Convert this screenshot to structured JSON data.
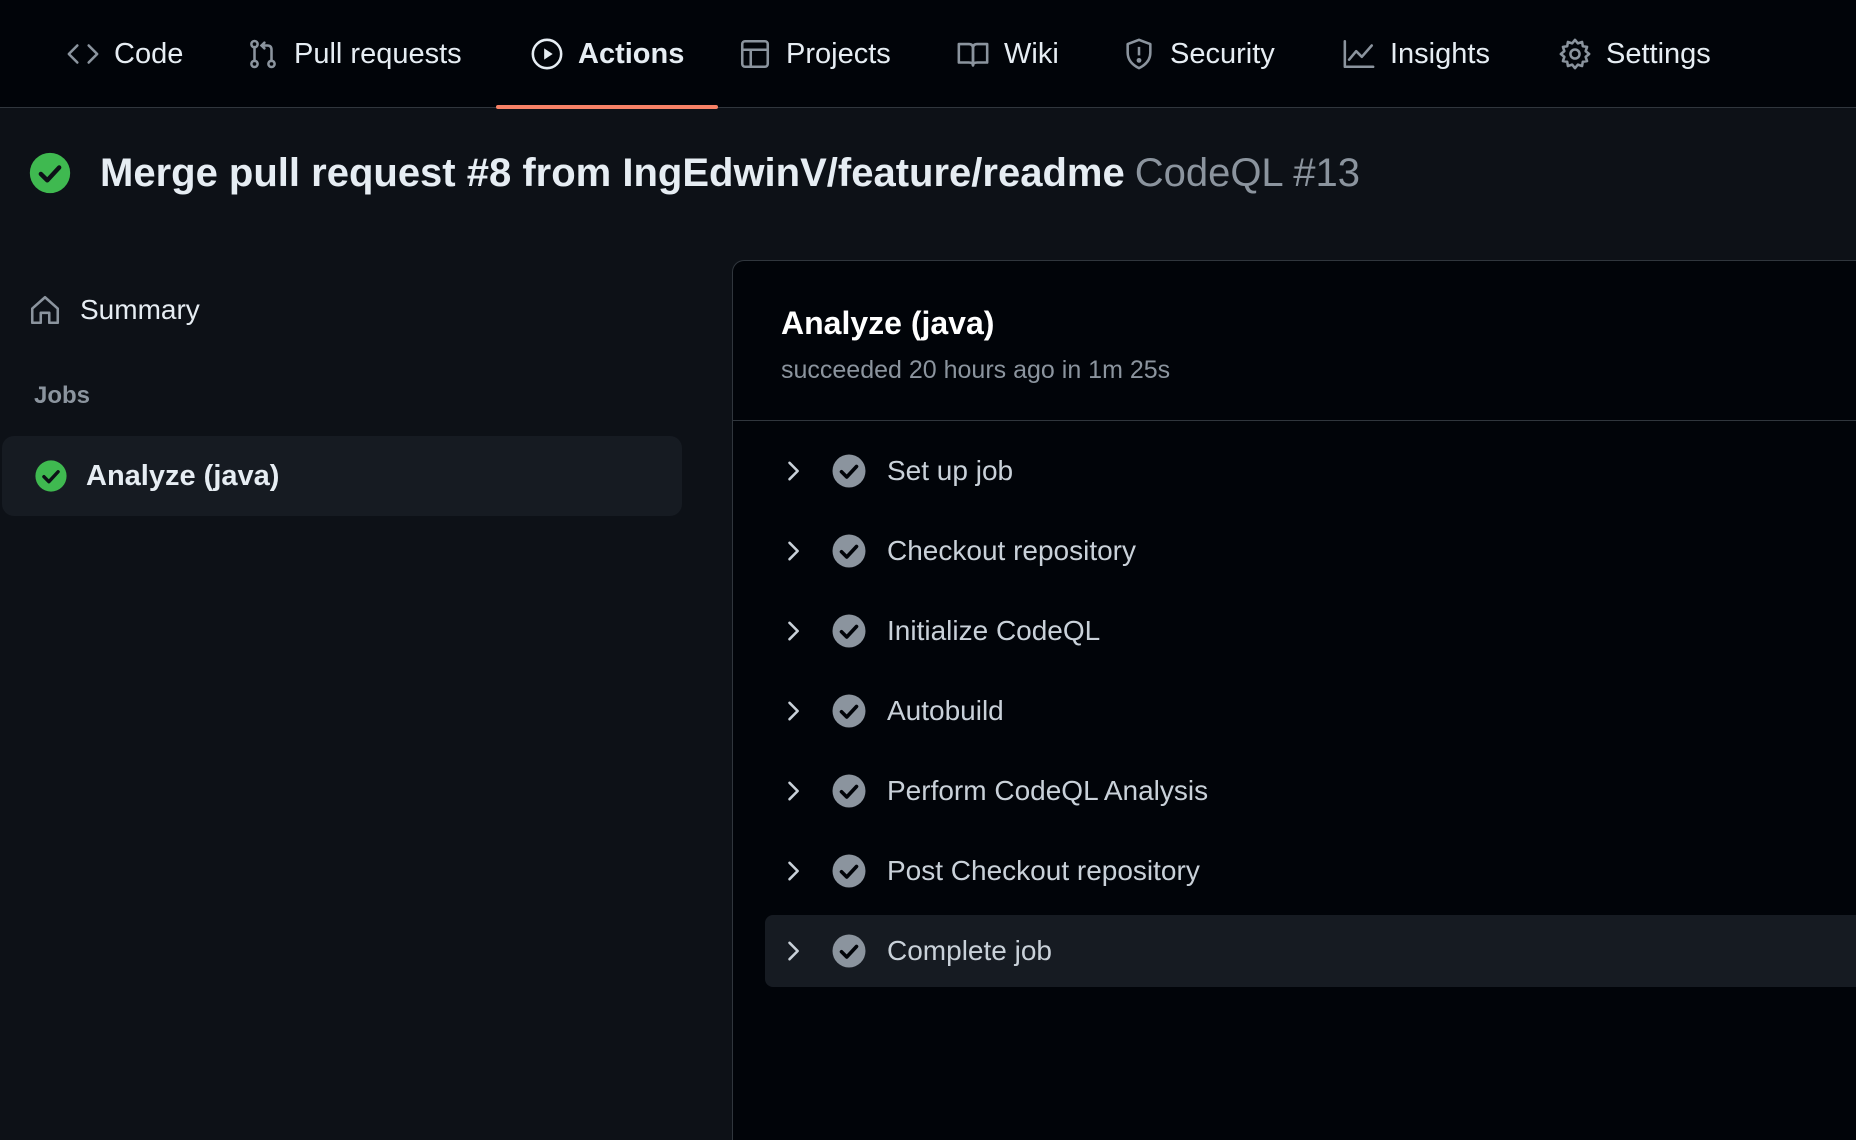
{
  "nav": {
    "tabs": [
      {
        "label": "Code",
        "icon": "code-icon"
      },
      {
        "label": "Pull requests",
        "icon": "git-pull-request-icon"
      },
      {
        "label": "Actions",
        "icon": "play-circle-icon"
      },
      {
        "label": "Projects",
        "icon": "table-icon"
      },
      {
        "label": "Wiki",
        "icon": "book-icon"
      },
      {
        "label": "Security",
        "icon": "shield-icon"
      },
      {
        "label": "Insights",
        "icon": "graph-icon"
      },
      {
        "label": "Settings",
        "icon": "gear-icon"
      }
    ],
    "active_tab": "Actions",
    "accent_color": "#f78166"
  },
  "run": {
    "title": "Merge pull request #8 from IngEdwinV/feature/readme",
    "workflow": "CodeQL #13",
    "status_icon": "check-circle-fill-icon",
    "success_color": "#3fb950"
  },
  "sidebar": {
    "summary_label": "Summary",
    "jobs_label": "Jobs",
    "job": {
      "label": "Analyze (java)",
      "status_icon": "check-circle-fill-icon"
    }
  },
  "job_panel": {
    "title": "Analyze (java)",
    "status_text": "succeeded 20 hours ago in 1m 25s",
    "steps": [
      {
        "label": "Set up job"
      },
      {
        "label": "Checkout repository"
      },
      {
        "label": "Initialize CodeQL"
      },
      {
        "label": "Autobuild"
      },
      {
        "label": "Perform CodeQL Analysis"
      },
      {
        "label": "Post Checkout repository"
      },
      {
        "label": "Complete job"
      }
    ]
  }
}
